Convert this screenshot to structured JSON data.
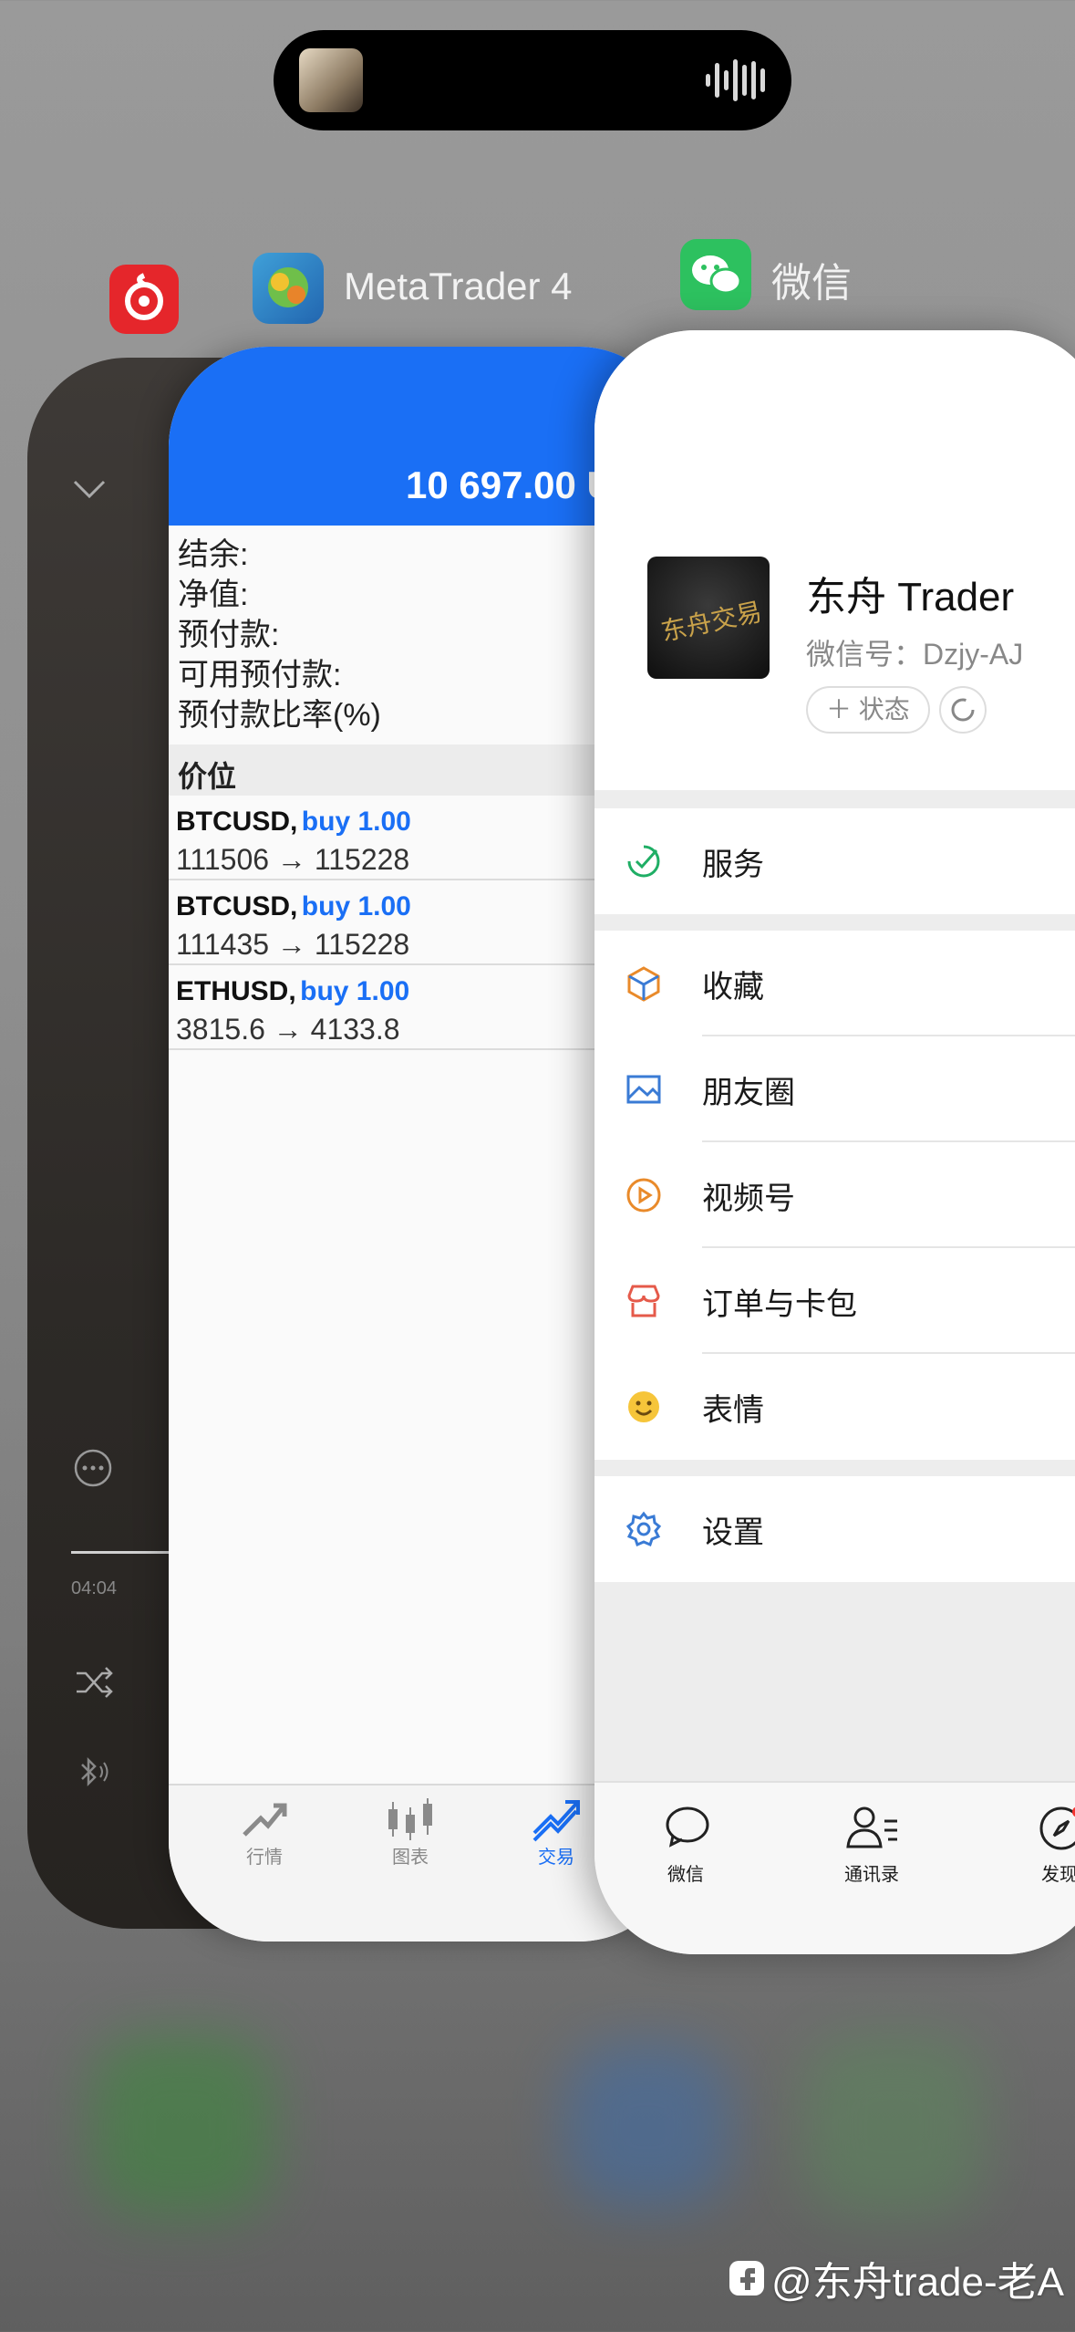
{
  "island": {
    "icons": [
      "album-art",
      "audio-wave-icon"
    ]
  },
  "app_switcher": {
    "apps": [
      {
        "name": "",
        "icon": "netease-music-icon"
      },
      {
        "name": "MetaTrader 4",
        "icon": "metatrader-icon"
      },
      {
        "name": "微信",
        "icon": "wechat-icon"
      }
    ]
  },
  "music": {
    "time": "04:04"
  },
  "mt4": {
    "balance": "10 697.00 U",
    "summary": [
      "结余:",
      "净值:",
      "预付款:",
      "可用预付款:",
      "预付款比率(%)"
    ],
    "section_header": "价位",
    "positions": [
      {
        "symbol": "BTCUSD,",
        "side": "buy 1.00",
        "prices": "111506 → 115228"
      },
      {
        "symbol": "BTCUSD,",
        "side": "buy 1.00",
        "prices": "111435 → 115228"
      },
      {
        "symbol": "ETHUSD,",
        "side": "buy 1.00",
        "prices": "3815.6 → 4133.8"
      }
    ],
    "tabs": [
      {
        "label": "行情",
        "icon": "quotes-icon",
        "active": false
      },
      {
        "label": "图表",
        "icon": "candlestick-icon",
        "active": false
      },
      {
        "label": "交易",
        "icon": "trade-icon",
        "active": true
      }
    ],
    "accent": "#1a6ff5"
  },
  "wechat": {
    "profile": {
      "name": "东舟 Trader",
      "wechat_id": "微信号：Dzjy-AJ",
      "status_btn": "＋ 状态",
      "avatar_text": "东舟交易"
    },
    "menu": [
      {
        "label": "服务",
        "icon": "service-icon"
      },
      {
        "label": "收藏",
        "icon": "favorites-icon"
      },
      {
        "label": "朋友圈",
        "icon": "moments-icon"
      },
      {
        "label": "视频号",
        "icon": "channels-icon"
      },
      {
        "label": "订单与卡包",
        "icon": "orders-icon"
      },
      {
        "label": "表情",
        "icon": "sticker-icon"
      },
      {
        "label": "设置",
        "icon": "settings-icon"
      }
    ],
    "tabs": [
      {
        "label": "微信",
        "icon": "chat-icon"
      },
      {
        "label": "通讯录",
        "icon": "contacts-icon"
      },
      {
        "label": "发现",
        "icon": "discover-icon"
      }
    ]
  },
  "watermark": "@东舟trade-老A"
}
